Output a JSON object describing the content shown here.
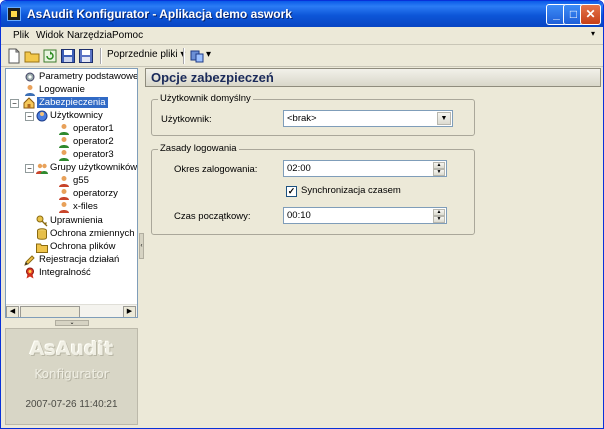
{
  "window": {
    "title": "AsAudit Konfigurator - Aplikacja demo  aswork",
    "minimize_glyph": "_",
    "maximize_glyph": "□",
    "close_glyph": "✕"
  },
  "menu": {
    "items": [
      {
        "label": "Plik"
      },
      {
        "label": "Widok"
      },
      {
        "label": "Narzędzia"
      },
      {
        "label": "Pomoc"
      }
    ],
    "chevron": "▾"
  },
  "toolbar": {
    "previous_files_label": "Poprzednie pliki",
    "dropdown_glyph": "▾"
  },
  "tree": {
    "nodes": [
      {
        "label": "Parametry podstawowe",
        "icon": "gear-icon",
        "selected": false
      },
      {
        "label": "Logowanie",
        "icon": "person-icon",
        "selected": false
      },
      {
        "label": "Zabezpieczenia",
        "icon": "house-lock-icon",
        "selected": true,
        "expander": "−"
      },
      {
        "label": "Użytkownicy",
        "icon": "users-globe-icon",
        "selected": false,
        "expander": "−"
      },
      {
        "label": "operator1",
        "icon": "user-icon",
        "selected": false
      },
      {
        "label": "operator2",
        "icon": "user-icon",
        "selected": false
      },
      {
        "label": "operator3",
        "icon": "user-icon",
        "selected": false
      },
      {
        "label": "Grupy użytkowników",
        "icon": "group-icon",
        "selected": false,
        "expander": "−"
      },
      {
        "label": "g55",
        "icon": "user-icon",
        "selected": false
      },
      {
        "label": "operatorzy",
        "icon": "user-icon",
        "selected": false
      },
      {
        "label": "x-files",
        "icon": "user-icon",
        "selected": false
      },
      {
        "label": "Uprawnienia",
        "icon": "key-icon",
        "selected": false
      },
      {
        "label": "Ochrona zmiennych",
        "icon": "database-icon",
        "selected": false
      },
      {
        "label": "Ochrona plików",
        "icon": "folder-icon",
        "selected": false
      },
      {
        "label": "Rejestracja działań",
        "icon": "pencil-icon",
        "selected": false
      },
      {
        "label": "Integralność",
        "icon": "award-icon",
        "selected": false
      }
    ]
  },
  "brand": {
    "name": "AsAudit",
    "subtitle": "Konfigurator",
    "datetime": "2007-07-26 11:40:21"
  },
  "content": {
    "header": "Opcje zabezpieczeń",
    "default_user_group": {
      "legend": "Użytkownik domyślny",
      "user_label": "Użytkownik:",
      "user_value": "<brak>"
    },
    "login_group": {
      "legend": "Zasady logowania",
      "period_label": "Okres zalogowania:",
      "period_value": "02:00",
      "sync_label": "Synchronizacja czasem",
      "sync_checked": true,
      "sync_check_glyph": "✓",
      "start_label": "Czas początkowy:",
      "start_value": "00:10"
    }
  },
  "colors": {
    "selection": "#316ac5",
    "titlebar": "#0a5ae8"
  }
}
